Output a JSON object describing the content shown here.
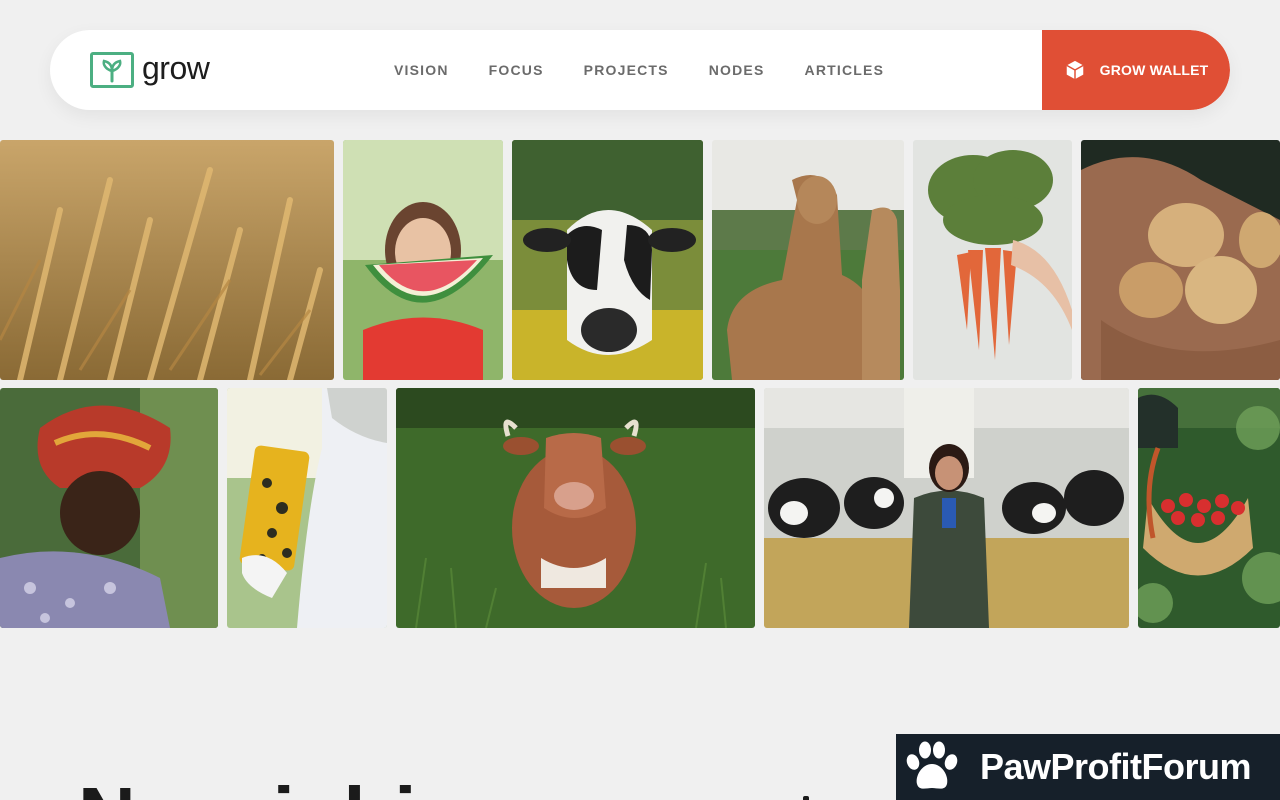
{
  "nav": {
    "logo_text": "grow",
    "menu": [
      "VISION",
      "FOCUS",
      "PROJECTS",
      "NODES",
      "ARTICLES"
    ],
    "wallet_label": "GROW WALLET",
    "wallet_icon": "cube-icon",
    "accent_color": "#e04f35",
    "logo_color": "#4caf82"
  },
  "gallery": {
    "row1": [
      "wheat-field-photo",
      "girl-with-watermelon-photo",
      "black-white-cow-photo",
      "alpacas-photo",
      "carrots-bunch-photo",
      "hands-with-potatoes-photo"
    ],
    "row2": [
      "woman-in-headwrap-photo",
      "beekeeper-honeycomb-photo",
      "brown-cow-in-grass-photo",
      "farmer-in-cow-barn-photo",
      "basket-of-strawberries-photo"
    ]
  },
  "section": {
    "heading": "Nourishing"
  },
  "badge": {
    "text": "PawProfitForum",
    "icon": "paw-icon"
  }
}
